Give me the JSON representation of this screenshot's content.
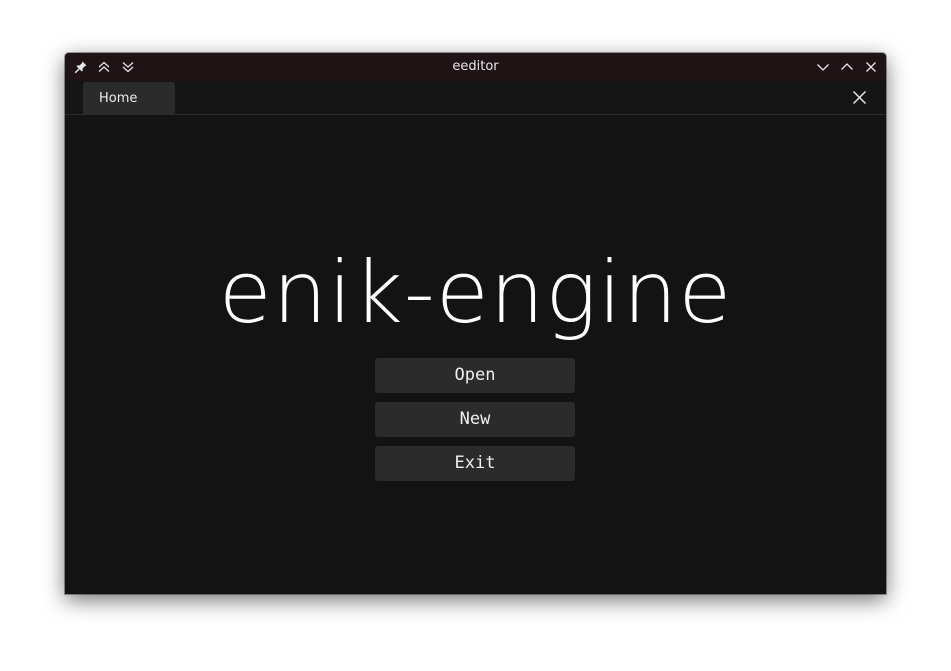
{
  "window": {
    "title": "eeditor"
  },
  "titlebar": {
    "left_icons": [
      "pin-icon",
      "keep-above-icon",
      "keep-below-icon"
    ],
    "right_icons": [
      "minimize-icon",
      "maximize-icon",
      "close-icon"
    ]
  },
  "tabs": [
    {
      "label": "Home",
      "active": true
    }
  ],
  "home": {
    "logo_text": "enik-engine",
    "buttons": {
      "open": "Open",
      "new": "New",
      "exit": "Exit"
    }
  },
  "colors": {
    "titlebar_bg": "#201316",
    "window_bg": "#131313",
    "button_bg": "#2b2b2b",
    "text": "#ffffff"
  }
}
